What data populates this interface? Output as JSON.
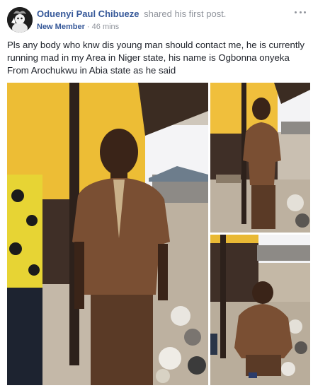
{
  "post": {
    "author": {
      "name": "Oduenyi Paul Chibueze",
      "action": "shared his first post."
    },
    "meta": {
      "badge": "New Member",
      "separator": "·",
      "time": "46 mins"
    },
    "text": "Pls any body who knw dis young man should contact me, he is currently running mad in my Area in Niger state, his name is Ogbonna onyeka From Arochukwu in Abia state as he said"
  },
  "colors": {
    "author_link": "#365899",
    "meta_gray": "#90949c",
    "body_text": "#1d2129"
  },
  "icons": {
    "avatar": "profile-avatar",
    "menu": "more-options-icon"
  }
}
